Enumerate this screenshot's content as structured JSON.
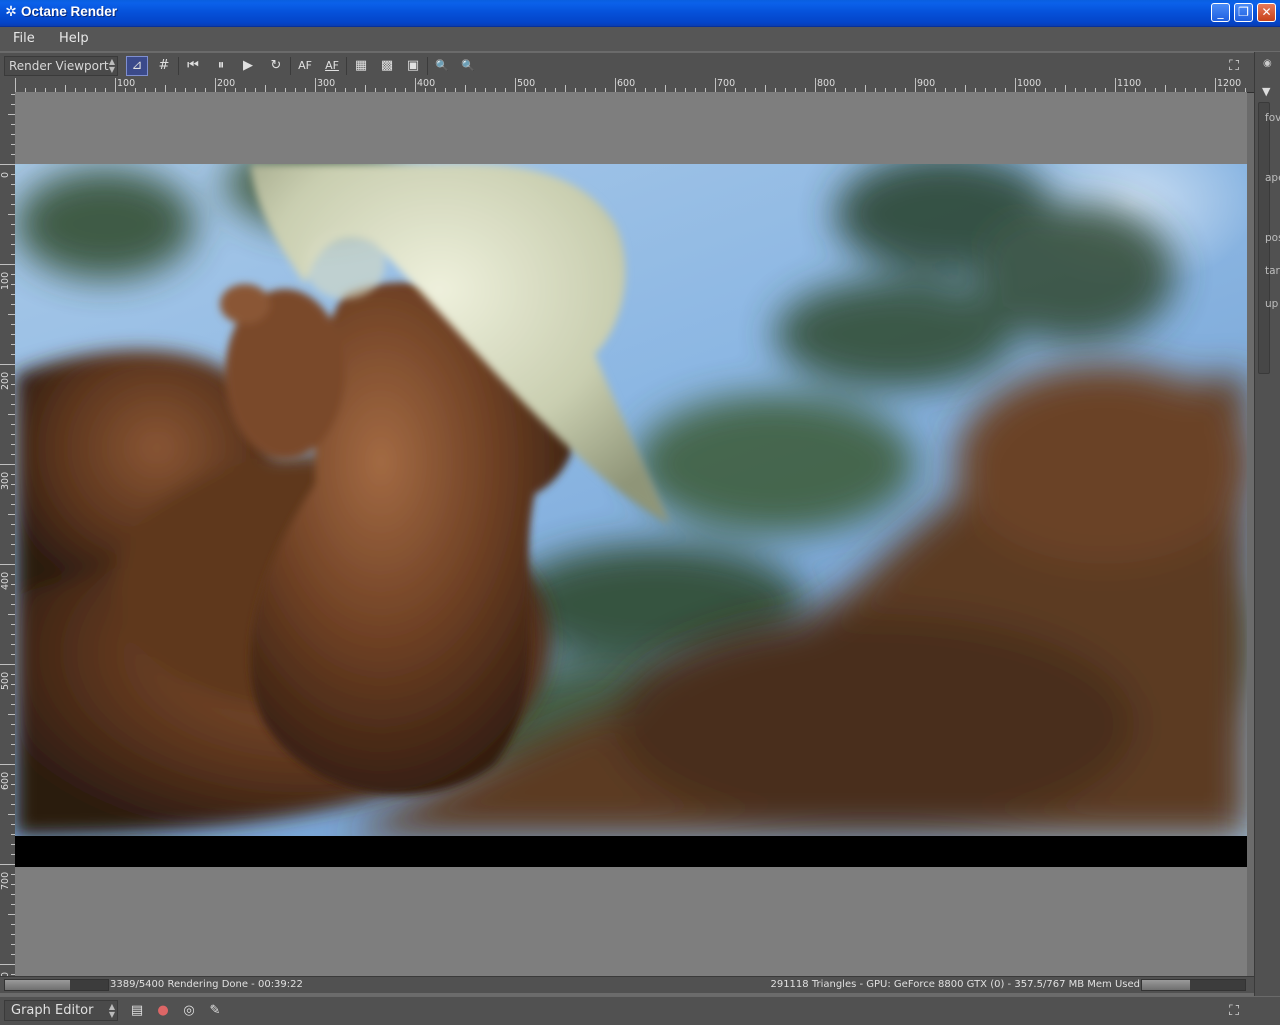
{
  "window": {
    "title": "Octane Render",
    "app_icon": "octane-logo-icon",
    "controls": {
      "minimize": "_",
      "maximize": "❐",
      "close": "✕"
    }
  },
  "menubar": {
    "items": [
      {
        "label": "File"
      },
      {
        "label": "Help"
      }
    ]
  },
  "toolbar": {
    "viewport_select": {
      "value": "Render Viewport"
    },
    "buttons": [
      {
        "icon": "picker-icon",
        "glyph": "⊿"
      },
      {
        "icon": "grid-icon",
        "glyph": "#"
      },
      {
        "icon": "restart-icon",
        "glyph": "⏮"
      },
      {
        "icon": "pause-icon",
        "glyph": "⏸"
      },
      {
        "icon": "play-icon",
        "glyph": "▶"
      },
      {
        "icon": "refresh-icon",
        "glyph": "↻"
      },
      {
        "icon": "autofocus-icon",
        "glyph": "AF"
      },
      {
        "icon": "autofocus-picker-icon",
        "glyph": "AF"
      },
      {
        "icon": "region-icon",
        "glyph": "▦"
      },
      {
        "icon": "alpha-checker-icon",
        "glyph": "▩"
      },
      {
        "icon": "checker-icon",
        "glyph": "▣"
      },
      {
        "icon": "zoom-in-icon",
        "glyph": "🔍"
      },
      {
        "icon": "zoom-out-icon",
        "glyph": "🔍"
      }
    ],
    "fullscreen_glyph": "⛶"
  },
  "rulers": {
    "horizontal_labels": [
      "100",
      "200",
      "300",
      "400",
      "500",
      "600",
      "700",
      "800",
      "900",
      "1000",
      "1100",
      "1200"
    ],
    "vertical_labels": [
      "0",
      "100",
      "200",
      "300",
      "400",
      "500",
      "600",
      "700",
      "00"
    ]
  },
  "side_panel": {
    "pin_glyph": "◉",
    "collapse_glyph": "▼",
    "labels": [
      "fov",
      "ape",
      "pos",
      "tar",
      "up"
    ]
  },
  "status": {
    "progress_fraction": 0.6276,
    "progress_text": "3389/5400 Rendering Done - 00:39:22",
    "info_text": "291118 Triangles - GPU: GeForce 8800 GTX (0) - 357.5/767 MB Mem Used",
    "memory_fraction": 0.466
  },
  "graph_editor": {
    "select_value": "Graph Editor",
    "buttons": [
      {
        "icon": "film-icon",
        "glyph": "▤"
      },
      {
        "icon": "material-icon",
        "glyph": "●"
      },
      {
        "icon": "render-icon",
        "glyph": "◎"
      },
      {
        "icon": "brush-icon",
        "glyph": "✎"
      }
    ],
    "fullscreen_glyph": "⛶"
  }
}
